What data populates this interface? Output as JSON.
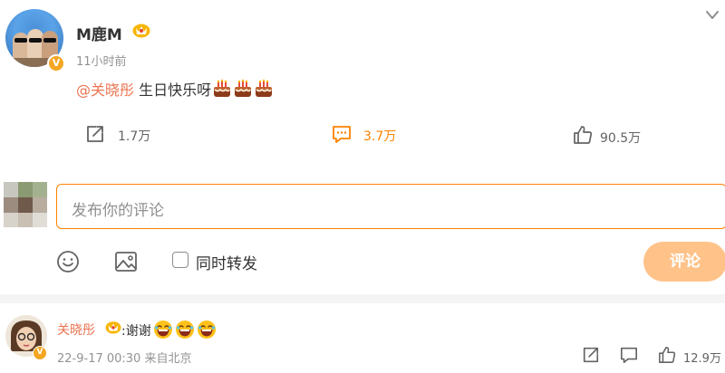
{
  "post": {
    "author": "M鹿M",
    "verified_badge": "V",
    "time": "11小时前",
    "mention": "@关晓彤",
    "text": " 生日快乐呀",
    "emoji_name": "cake-emoji",
    "emoji_count": 3
  },
  "actions": {
    "repost_count": "1.7万",
    "comment_count": "3.7万",
    "like_count": "90.5万"
  },
  "compose": {
    "placeholder": "发布你的评论",
    "also_repost_label": "同时转发",
    "submit_label": "评论"
  },
  "reply": {
    "author": "关晓彤",
    "verified_badge": "V",
    "text": ":谢谢",
    "emoji_name": "laugh-emoji",
    "emoji_count": 3,
    "meta": "22-9-17 00:30 来自北京",
    "like_count": "12.9万"
  },
  "colors": {
    "accent_orange": "#ff8200",
    "mention_color": "#eb7350",
    "button_disabled": "#ffc38a"
  }
}
